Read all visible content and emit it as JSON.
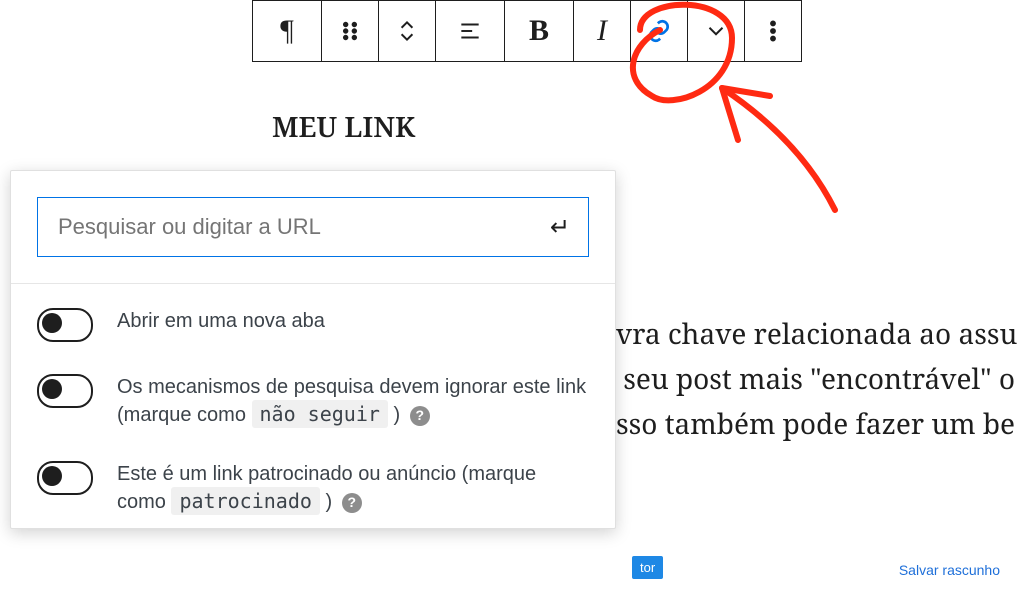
{
  "toolbar": {
    "paragraph_icon": "¶",
    "bold_label": "B",
    "italic_label": "I"
  },
  "content": {
    "headline": "MEU LINK",
    "body_fragment": "vra chave relacionada ao assu\n seu post mais \"encontrável\" o\nsso também pode fazer um be"
  },
  "link_popover": {
    "placeholder": "Pesquisar ou digitar a URL",
    "options": [
      {
        "label_plain": "Abrir em uma nova aba",
        "code": null,
        "help": false
      },
      {
        "label_pre": "Os mecanismos de pesquisa devem ignorar este link (marque como ",
        "code": "não seguir",
        "label_post": ")",
        "help": true
      },
      {
        "label_pre": "Este é um link patrocinado ou anúncio (marque como ",
        "code": "patrocinado",
        "label_post": ")",
        "help": true
      }
    ]
  },
  "footer": {
    "editor_chip": "tor",
    "save_draft": "Salvar rascunho"
  }
}
